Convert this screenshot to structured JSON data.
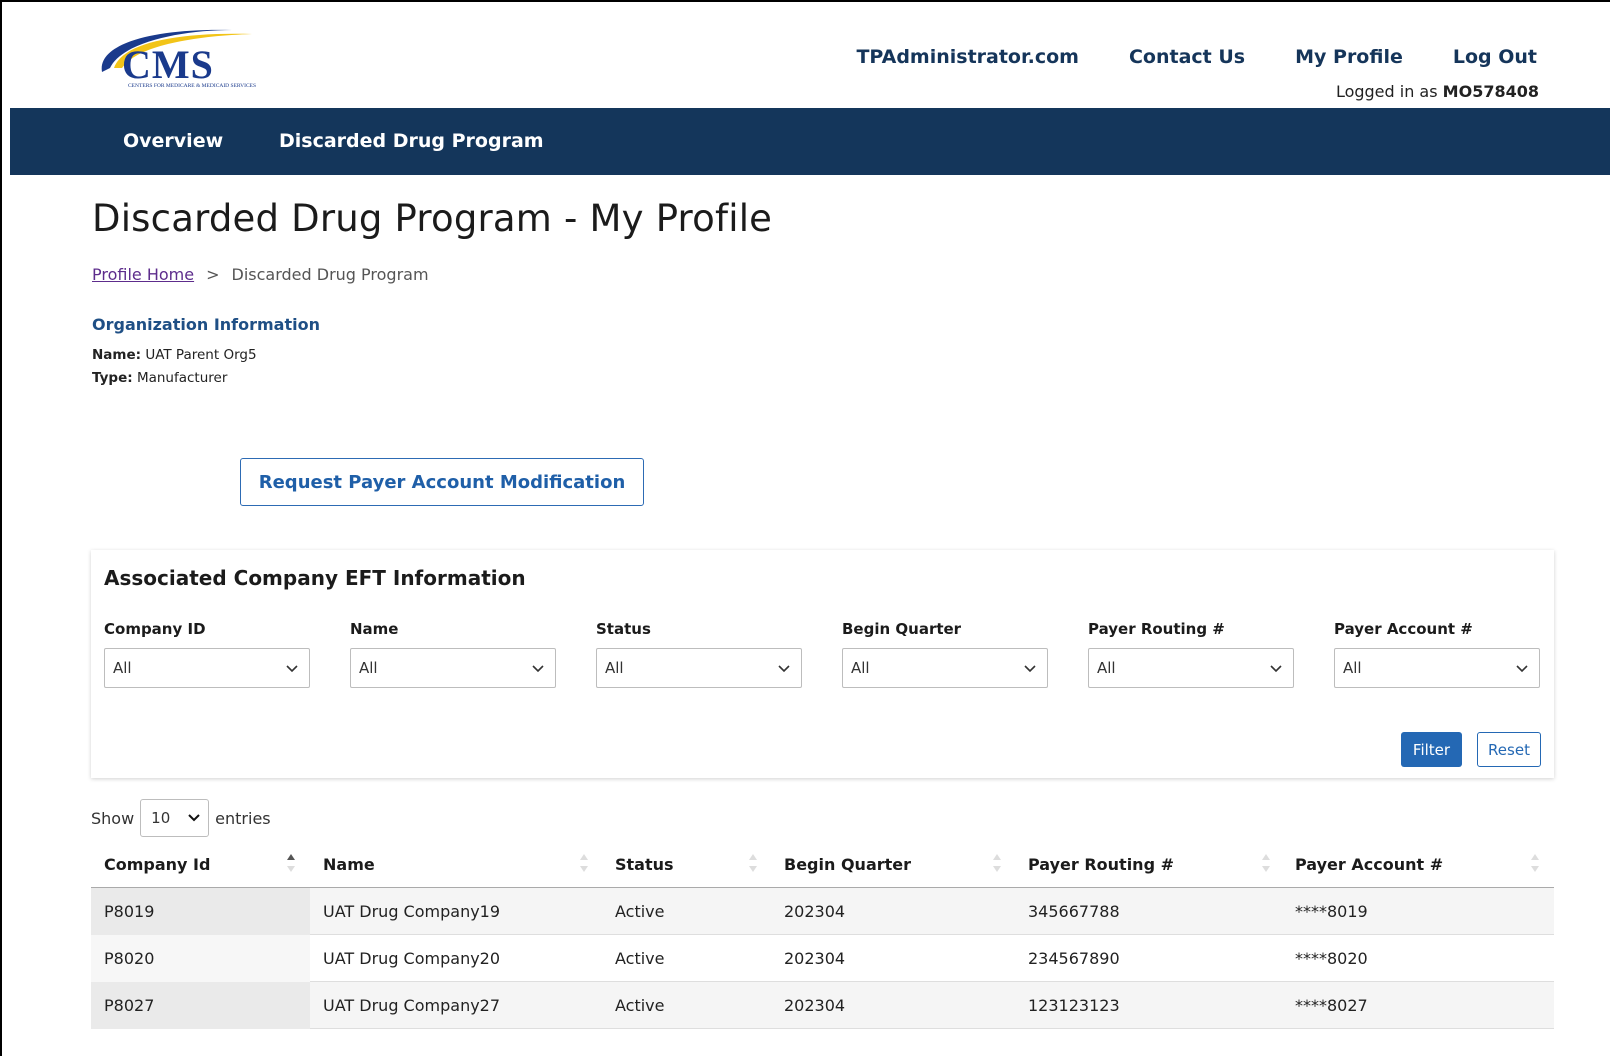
{
  "header": {
    "logo_text": "CMS",
    "logo_subtext": "CENTERS FOR MEDICARE & MEDICAID SERVICES",
    "links": [
      "TPAdministrator.com",
      "Contact Us",
      "My Profile",
      "Log Out"
    ],
    "logged_in_prefix": "Logged in as",
    "logged_in_user": "MO578408"
  },
  "nav": {
    "items": [
      "Overview",
      "Discarded Drug Program"
    ]
  },
  "page": {
    "title": "Discarded Drug Program - My Profile",
    "breadcrumb": {
      "home": "Profile Home",
      "separator": ">",
      "current": "Discarded Drug Program"
    },
    "org": {
      "heading": "Organization Information",
      "name_label": "Name:",
      "name_value": "UAT Parent Org5",
      "type_label": "Type:",
      "type_value": "Manufacturer"
    },
    "request_button": "Request Payer Account Modification"
  },
  "filter_panel": {
    "title": "Associated Company EFT Information",
    "filters": [
      {
        "label": "Company ID",
        "value": "All"
      },
      {
        "label": "Name",
        "value": "All"
      },
      {
        "label": "Status",
        "value": "All"
      },
      {
        "label": "Begin Quarter",
        "value": "All"
      },
      {
        "label": "Payer Routing #",
        "value": "All"
      },
      {
        "label": "Payer Account #",
        "value": "All"
      }
    ],
    "filter_button": "Filter",
    "reset_button": "Reset"
  },
  "table": {
    "show_label": "Show",
    "entries_value": "10",
    "entries_label": "entries",
    "columns": [
      "Company Id",
      "Name",
      "Status",
      "Begin Quarter",
      "Payer Routing #",
      "Payer Account #"
    ],
    "rows": [
      [
        "P8019",
        "UAT Drug Company19",
        "Active",
        "202304",
        "345667788",
        "****8019"
      ],
      [
        "P8020",
        "UAT Drug Company20",
        "Active",
        "202304",
        "234567890",
        "****8020"
      ],
      [
        "P8027",
        "UAT Drug Company27",
        "Active",
        "202304",
        "123123123",
        "****8027"
      ]
    ]
  },
  "colors": {
    "navbar": "#14365b",
    "link": "#15355a",
    "primary": "#2468b4",
    "org_heading": "#1f4f85",
    "breadcrumb_link": "#5d2c8c"
  }
}
